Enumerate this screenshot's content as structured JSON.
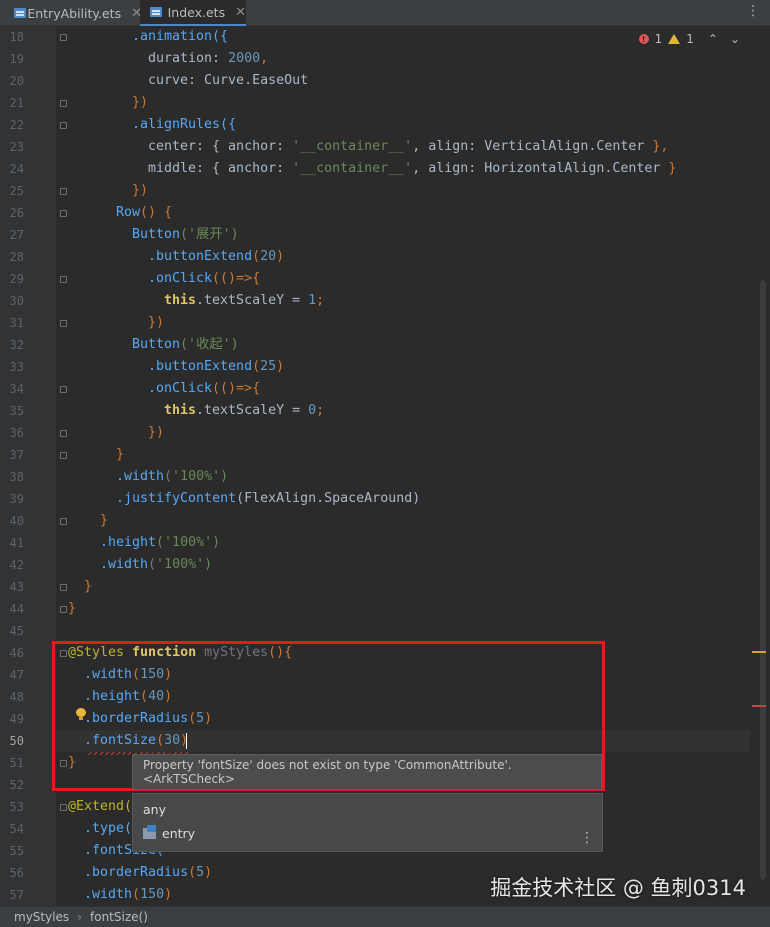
{
  "tabs": [
    {
      "label": "EntryAbility.ets",
      "active": false
    },
    {
      "label": "Index.ets",
      "active": true
    }
  ],
  "inspection": {
    "errors": "1",
    "warnings": "1"
  },
  "current_line": 50,
  "lines": [
    {
      "n": 18,
      "tokens": [
        {
          "t": ".animation({",
          "c": "func"
        }
      ]
    },
    {
      "n": 19,
      "tokens": [
        {
          "t": "duration: ",
          "c": "pl"
        },
        {
          "t": "2000",
          "c": "n"
        },
        {
          "t": ",",
          "c": "k"
        }
      ]
    },
    {
      "n": 20,
      "tokens": [
        {
          "t": "curve: Curve.EaseOut",
          "c": "pl"
        }
      ]
    },
    {
      "n": 21,
      "tokens": [
        {
          "t": "})",
          "c": "k"
        }
      ]
    },
    {
      "n": 22,
      "tokens": [
        {
          "t": ".alignRules({",
          "c": "func"
        }
      ]
    },
    {
      "n": 23,
      "tokens": [
        {
          "t": "center: { anchor: ",
          "c": "pl"
        },
        {
          "t": "'__container__'",
          "c": "s"
        },
        {
          "t": ", align: VerticalAlign.Center ",
          "c": "pl"
        },
        {
          "t": "},",
          "c": "k"
        }
      ]
    },
    {
      "n": 24,
      "tokens": [
        {
          "t": "middle: { anchor: ",
          "c": "pl"
        },
        {
          "t": "'__container__'",
          "c": "s"
        },
        {
          "t": ", align: HorizontalAlign.Center ",
          "c": "pl"
        },
        {
          "t": "}",
          "c": "k"
        }
      ]
    },
    {
      "n": 25,
      "tokens": [
        {
          "t": "})",
          "c": "k"
        }
      ]
    },
    {
      "n": 26,
      "tokens": [
        {
          "t": "Row",
          "c": "func"
        },
        {
          "t": "() {",
          "c": "k"
        }
      ]
    },
    {
      "n": 27,
      "tokens": [
        {
          "t": "Button",
          "c": "func"
        },
        {
          "t": "('展开')",
          "c": "s"
        }
      ]
    },
    {
      "n": 28,
      "tokens": [
        {
          "t": ".buttonExtend",
          "c": "func"
        },
        {
          "t": "(",
          "c": "k"
        },
        {
          "t": "20",
          "c": "n"
        },
        {
          "t": ")",
          "c": "k"
        }
      ]
    },
    {
      "n": 29,
      "tokens": [
        {
          "t": ".onClick",
          "c": "func"
        },
        {
          "t": "(()=>{",
          "c": "k"
        }
      ]
    },
    {
      "n": 30,
      "tokens": [
        {
          "t": "this",
          "c": "kw"
        },
        {
          "t": ".textScaleY = ",
          "c": "pl"
        },
        {
          "t": "1",
          "c": "n"
        },
        {
          "t": ";",
          "c": "k"
        }
      ]
    },
    {
      "n": 31,
      "tokens": [
        {
          "t": "})",
          "c": "k"
        }
      ]
    },
    {
      "n": 32,
      "tokens": [
        {
          "t": "Button",
          "c": "func"
        },
        {
          "t": "('收起')",
          "c": "s"
        }
      ]
    },
    {
      "n": 33,
      "tokens": [
        {
          "t": ".buttonExtend",
          "c": "func"
        },
        {
          "t": "(",
          "c": "k"
        },
        {
          "t": "25",
          "c": "n"
        },
        {
          "t": ")",
          "c": "k"
        }
      ]
    },
    {
      "n": 34,
      "tokens": [
        {
          "t": ".onClick",
          "c": "func"
        },
        {
          "t": "(()=>{",
          "c": "k"
        }
      ]
    },
    {
      "n": 35,
      "tokens": [
        {
          "t": "this",
          "c": "kw"
        },
        {
          "t": ".textScaleY = ",
          "c": "pl"
        },
        {
          "t": "0",
          "c": "n"
        },
        {
          "t": ";",
          "c": "k"
        }
      ]
    },
    {
      "n": 36,
      "tokens": [
        {
          "t": "})",
          "c": "k"
        }
      ]
    },
    {
      "n": 37,
      "tokens": [
        {
          "t": "}",
          "c": "k"
        }
      ]
    },
    {
      "n": 38,
      "tokens": [
        {
          "t": ".width",
          "c": "func"
        },
        {
          "t": "('100%')",
          "c": "s"
        }
      ]
    },
    {
      "n": 39,
      "tokens": [
        {
          "t": ".justifyContent",
          "c": "func"
        },
        {
          "t": "(FlexAlign.SpaceAround)",
          "c": "pl"
        }
      ]
    },
    {
      "n": 40,
      "tokens": [
        {
          "t": "}",
          "c": "k"
        }
      ]
    },
    {
      "n": 41,
      "tokens": [
        {
          "t": ".height",
          "c": "func"
        },
        {
          "t": "('100%')",
          "c": "s"
        }
      ]
    },
    {
      "n": 42,
      "tokens": [
        {
          "t": ".width",
          "c": "func"
        },
        {
          "t": "('100%')",
          "c": "s"
        }
      ]
    },
    {
      "n": 43,
      "tokens": [
        {
          "t": "}",
          "c": "k"
        }
      ]
    },
    {
      "n": 44,
      "tokens": [
        {
          "t": "}",
          "c": "k"
        }
      ]
    },
    {
      "n": 45,
      "tokens": []
    },
    {
      "n": 46,
      "tokens": [
        {
          "t": "@Styles ",
          "c": "a"
        },
        {
          "t": "function ",
          "c": "kw"
        },
        {
          "t": "myStyles",
          "c": "fn-dim"
        },
        {
          "t": "(){",
          "c": "k"
        }
      ]
    },
    {
      "n": 47,
      "tokens": [
        {
          "t": ".width",
          "c": "func"
        },
        {
          "t": "(",
          "c": "k"
        },
        {
          "t": "150",
          "c": "n"
        },
        {
          "t": ")",
          "c": "k"
        }
      ]
    },
    {
      "n": 48,
      "tokens": [
        {
          "t": ".height",
          "c": "func"
        },
        {
          "t": "(",
          "c": "k"
        },
        {
          "t": "40",
          "c": "n"
        },
        {
          "t": ")",
          "c": "k"
        }
      ]
    },
    {
      "n": 49,
      "tokens": [
        {
          "t": ".borderRadius",
          "c": "func"
        },
        {
          "t": "(",
          "c": "k"
        },
        {
          "t": "5",
          "c": "n"
        },
        {
          "t": ")",
          "c": "k"
        }
      ]
    },
    {
      "n": 50,
      "tokens": [
        {
          "t": ".fontSize",
          "c": "func"
        },
        {
          "t": "(",
          "c": "k"
        },
        {
          "t": "30",
          "c": "n"
        },
        {
          "t": ")",
          "c": "k"
        }
      ]
    },
    {
      "n": 51,
      "tokens": [
        {
          "t": "}",
          "c": "k"
        }
      ]
    },
    {
      "n": 52,
      "tokens": []
    },
    {
      "n": 53,
      "tokens": [
        {
          "t": "@Extend(",
          "c": "a"
        }
      ]
    },
    {
      "n": 54,
      "tokens": [
        {
          "t": ".type(",
          "c": "func"
        }
      ]
    },
    {
      "n": 55,
      "tokens": [
        {
          "t": ".fontSize(",
          "c": "func"
        }
      ]
    },
    {
      "n": 56,
      "tokens": [
        {
          "t": ".borderRadius",
          "c": "func"
        },
        {
          "t": "(",
          "c": "k"
        },
        {
          "t": "5",
          "c": "n"
        },
        {
          "t": ")",
          "c": "k"
        }
      ]
    },
    {
      "n": 57,
      "tokens": [
        {
          "t": ".width",
          "c": "func"
        },
        {
          "t": "(",
          "c": "k"
        },
        {
          "t": "150",
          "c": "n"
        },
        {
          "t": ")",
          "c": "k"
        }
      ]
    }
  ],
  "tooltip": {
    "text": "Property 'fontSize' does not exist on type 'CommonAttribute'. <ArkTSCheck>"
  },
  "completion": {
    "items": [
      {
        "label": "any"
      },
      {
        "label": "entry",
        "icon": "package-icon"
      }
    ]
  },
  "breadcrumb": [
    "myStyles",
    "fontSize()"
  ],
  "watermark": "掘金技术社区 @ 鱼刺0314"
}
